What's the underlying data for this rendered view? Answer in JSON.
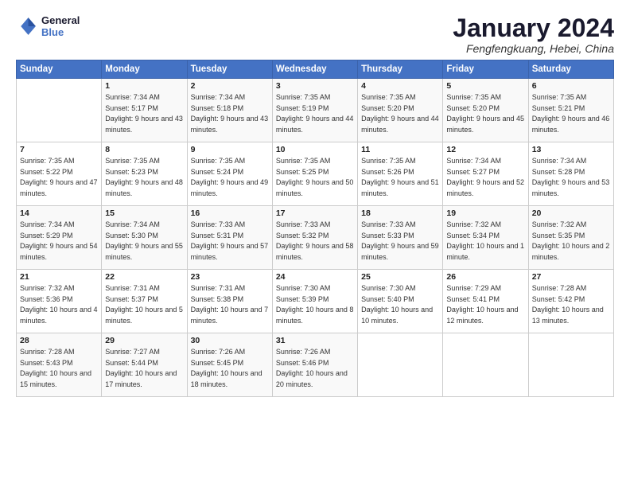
{
  "logo": {
    "line1": "General",
    "line2": "Blue"
  },
  "title": "January 2024",
  "location": "Fengfengkuang, Hebei, China",
  "days_header": [
    "Sunday",
    "Monday",
    "Tuesday",
    "Wednesday",
    "Thursday",
    "Friday",
    "Saturday"
  ],
  "weeks": [
    [
      {
        "num": "",
        "sunrise": "",
        "sunset": "",
        "daylight": ""
      },
      {
        "num": "1",
        "sunrise": "Sunrise: 7:34 AM",
        "sunset": "Sunset: 5:17 PM",
        "daylight": "Daylight: 9 hours and 43 minutes."
      },
      {
        "num": "2",
        "sunrise": "Sunrise: 7:34 AM",
        "sunset": "Sunset: 5:18 PM",
        "daylight": "Daylight: 9 hours and 43 minutes."
      },
      {
        "num": "3",
        "sunrise": "Sunrise: 7:35 AM",
        "sunset": "Sunset: 5:19 PM",
        "daylight": "Daylight: 9 hours and 44 minutes."
      },
      {
        "num": "4",
        "sunrise": "Sunrise: 7:35 AM",
        "sunset": "Sunset: 5:20 PM",
        "daylight": "Daylight: 9 hours and 44 minutes."
      },
      {
        "num": "5",
        "sunrise": "Sunrise: 7:35 AM",
        "sunset": "Sunset: 5:20 PM",
        "daylight": "Daylight: 9 hours and 45 minutes."
      },
      {
        "num": "6",
        "sunrise": "Sunrise: 7:35 AM",
        "sunset": "Sunset: 5:21 PM",
        "daylight": "Daylight: 9 hours and 46 minutes."
      }
    ],
    [
      {
        "num": "7",
        "sunrise": "Sunrise: 7:35 AM",
        "sunset": "Sunset: 5:22 PM",
        "daylight": "Daylight: 9 hours and 47 minutes."
      },
      {
        "num": "8",
        "sunrise": "Sunrise: 7:35 AM",
        "sunset": "Sunset: 5:23 PM",
        "daylight": "Daylight: 9 hours and 48 minutes."
      },
      {
        "num": "9",
        "sunrise": "Sunrise: 7:35 AM",
        "sunset": "Sunset: 5:24 PM",
        "daylight": "Daylight: 9 hours and 49 minutes."
      },
      {
        "num": "10",
        "sunrise": "Sunrise: 7:35 AM",
        "sunset": "Sunset: 5:25 PM",
        "daylight": "Daylight: 9 hours and 50 minutes."
      },
      {
        "num": "11",
        "sunrise": "Sunrise: 7:35 AM",
        "sunset": "Sunset: 5:26 PM",
        "daylight": "Daylight: 9 hours and 51 minutes."
      },
      {
        "num": "12",
        "sunrise": "Sunrise: 7:34 AM",
        "sunset": "Sunset: 5:27 PM",
        "daylight": "Daylight: 9 hours and 52 minutes."
      },
      {
        "num": "13",
        "sunrise": "Sunrise: 7:34 AM",
        "sunset": "Sunset: 5:28 PM",
        "daylight": "Daylight: 9 hours and 53 minutes."
      }
    ],
    [
      {
        "num": "14",
        "sunrise": "Sunrise: 7:34 AM",
        "sunset": "Sunset: 5:29 PM",
        "daylight": "Daylight: 9 hours and 54 minutes."
      },
      {
        "num": "15",
        "sunrise": "Sunrise: 7:34 AM",
        "sunset": "Sunset: 5:30 PM",
        "daylight": "Daylight: 9 hours and 55 minutes."
      },
      {
        "num": "16",
        "sunrise": "Sunrise: 7:33 AM",
        "sunset": "Sunset: 5:31 PM",
        "daylight": "Daylight: 9 hours and 57 minutes."
      },
      {
        "num": "17",
        "sunrise": "Sunrise: 7:33 AM",
        "sunset": "Sunset: 5:32 PM",
        "daylight": "Daylight: 9 hours and 58 minutes."
      },
      {
        "num": "18",
        "sunrise": "Sunrise: 7:33 AM",
        "sunset": "Sunset: 5:33 PM",
        "daylight": "Daylight: 9 hours and 59 minutes."
      },
      {
        "num": "19",
        "sunrise": "Sunrise: 7:32 AM",
        "sunset": "Sunset: 5:34 PM",
        "daylight": "Daylight: 10 hours and 1 minute."
      },
      {
        "num": "20",
        "sunrise": "Sunrise: 7:32 AM",
        "sunset": "Sunset: 5:35 PM",
        "daylight": "Daylight: 10 hours and 2 minutes."
      }
    ],
    [
      {
        "num": "21",
        "sunrise": "Sunrise: 7:32 AM",
        "sunset": "Sunset: 5:36 PM",
        "daylight": "Daylight: 10 hours and 4 minutes."
      },
      {
        "num": "22",
        "sunrise": "Sunrise: 7:31 AM",
        "sunset": "Sunset: 5:37 PM",
        "daylight": "Daylight: 10 hours and 5 minutes."
      },
      {
        "num": "23",
        "sunrise": "Sunrise: 7:31 AM",
        "sunset": "Sunset: 5:38 PM",
        "daylight": "Daylight: 10 hours and 7 minutes."
      },
      {
        "num": "24",
        "sunrise": "Sunrise: 7:30 AM",
        "sunset": "Sunset: 5:39 PM",
        "daylight": "Daylight: 10 hours and 8 minutes."
      },
      {
        "num": "25",
        "sunrise": "Sunrise: 7:30 AM",
        "sunset": "Sunset: 5:40 PM",
        "daylight": "Daylight: 10 hours and 10 minutes."
      },
      {
        "num": "26",
        "sunrise": "Sunrise: 7:29 AM",
        "sunset": "Sunset: 5:41 PM",
        "daylight": "Daylight: 10 hours and 12 minutes."
      },
      {
        "num": "27",
        "sunrise": "Sunrise: 7:28 AM",
        "sunset": "Sunset: 5:42 PM",
        "daylight": "Daylight: 10 hours and 13 minutes."
      }
    ],
    [
      {
        "num": "28",
        "sunrise": "Sunrise: 7:28 AM",
        "sunset": "Sunset: 5:43 PM",
        "daylight": "Daylight: 10 hours and 15 minutes."
      },
      {
        "num": "29",
        "sunrise": "Sunrise: 7:27 AM",
        "sunset": "Sunset: 5:44 PM",
        "daylight": "Daylight: 10 hours and 17 minutes."
      },
      {
        "num": "30",
        "sunrise": "Sunrise: 7:26 AM",
        "sunset": "Sunset: 5:45 PM",
        "daylight": "Daylight: 10 hours and 18 minutes."
      },
      {
        "num": "31",
        "sunrise": "Sunrise: 7:26 AM",
        "sunset": "Sunset: 5:46 PM",
        "daylight": "Daylight: 10 hours and 20 minutes."
      },
      {
        "num": "",
        "sunrise": "",
        "sunset": "",
        "daylight": ""
      },
      {
        "num": "",
        "sunrise": "",
        "sunset": "",
        "daylight": ""
      },
      {
        "num": "",
        "sunrise": "",
        "sunset": "",
        "daylight": ""
      }
    ]
  ]
}
